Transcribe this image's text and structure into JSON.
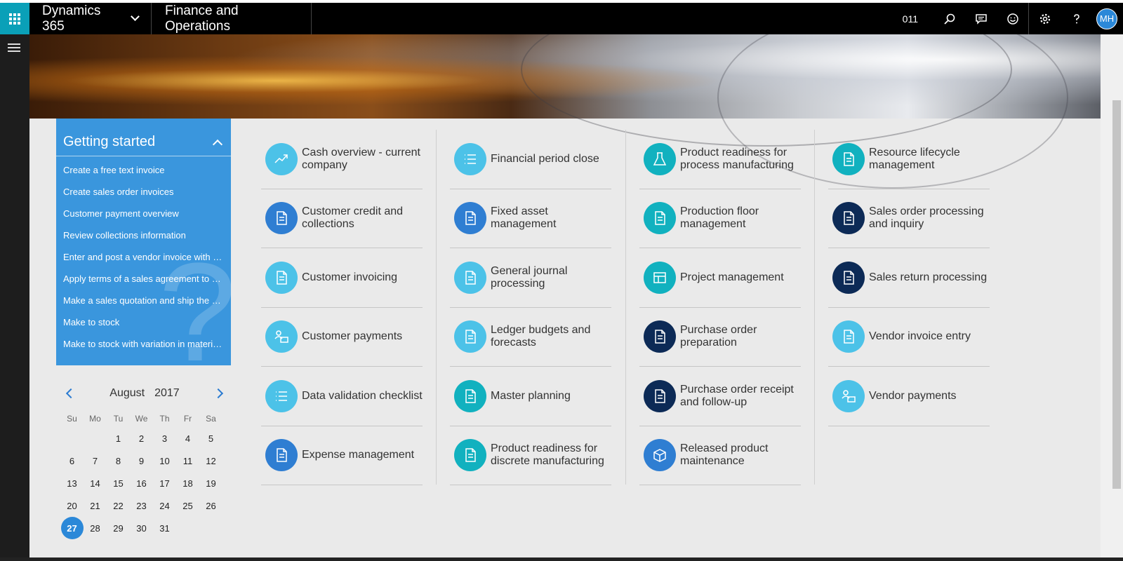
{
  "topbar": {
    "brand": "Dynamics 365",
    "module": "Finance and Operations",
    "company": "011",
    "avatar_initials": "MH",
    "icons": [
      "search-icon",
      "message-icon",
      "feedback-smiley-icon",
      "settings-icon",
      "help-icon"
    ]
  },
  "getting_started": {
    "title": "Getting started",
    "links": [
      "Create a free text invoice",
      "Create sales order invoices",
      "Customer payment overview",
      "Review collections information",
      "Enter and post a vendor invoice with m...",
      "Apply terms of a sales agreement to a ...",
      "Make a sales quotation and ship the or...",
      "Make to stock",
      "Make to stock with variation in materia..."
    ]
  },
  "calendar": {
    "month": "August",
    "year": "2017",
    "weekdays": [
      "Su",
      "Mo",
      "Tu",
      "We",
      "Th",
      "Fr",
      "Sa"
    ],
    "days": [
      "",
      "",
      "1",
      "2",
      "3",
      "4",
      "5",
      "6",
      "7",
      "8",
      "9",
      "10",
      "11",
      "12",
      "13",
      "14",
      "15",
      "16",
      "17",
      "18",
      "19",
      "20",
      "21",
      "22",
      "23",
      "24",
      "25",
      "26",
      "27",
      "28",
      "29",
      "30",
      "31"
    ],
    "today": "27"
  },
  "tiles": {
    "col1": [
      {
        "label": "Cash overview - current company",
        "icon": "trend-icon",
        "color": "#4cc2e8"
      },
      {
        "label": "Customer credit and collections",
        "icon": "credit-icon",
        "color": "#2f7ed2"
      },
      {
        "label": "Customer invoicing",
        "icon": "invoice-icon",
        "color": "#4cc2e8"
      },
      {
        "label": "Customer payments",
        "icon": "customer-payment-icon",
        "color": "#4cc2e8"
      },
      {
        "label": "Data validation checklist",
        "icon": "checklist-icon",
        "color": "#4cc2e8"
      },
      {
        "label": "Expense management",
        "icon": "expense-icon",
        "color": "#2f7ed2"
      }
    ],
    "col2": [
      {
        "label": "Financial period close",
        "icon": "list-icon",
        "color": "#4cc2e8"
      },
      {
        "label": "Fixed asset management",
        "icon": "asset-icon",
        "color": "#2f7ed2"
      },
      {
        "label": "General journal processing",
        "icon": "journal-icon",
        "color": "#4cc2e8"
      },
      {
        "label": "Ledger budgets and forecasts",
        "icon": "budget-icon",
        "color": "#4cc2e8"
      },
      {
        "label": "Master planning",
        "icon": "planning-icon",
        "color": "#11b1bf"
      },
      {
        "label": "Product readiness for discrete manufacturing",
        "icon": "product-readiness-icon",
        "color": "#11b1bf"
      }
    ],
    "col3": [
      {
        "label": "Product readiness for process manufacturing",
        "icon": "flask-icon",
        "color": "#11b1bf"
      },
      {
        "label": "Production floor management",
        "icon": "production-icon",
        "color": "#11b1bf"
      },
      {
        "label": "Project management",
        "icon": "project-icon",
        "color": "#11b1bf"
      },
      {
        "label": "Purchase order preparation",
        "icon": "purchase-prep-icon",
        "color": "#0c2a56"
      },
      {
        "label": "Purchase order receipt and follow-up",
        "icon": "purchase-receipt-icon",
        "color": "#0c2a56"
      },
      {
        "label": "Released product maintenance",
        "icon": "box-icon",
        "color": "#2f7ed2"
      }
    ],
    "col4": [
      {
        "label": "Resource lifecycle management",
        "icon": "resource-icon",
        "color": "#11b1bf"
      },
      {
        "label": "Sales order processing and inquiry",
        "icon": "sales-order-icon",
        "color": "#0c2a56"
      },
      {
        "label": "Sales return processing",
        "icon": "sales-return-icon",
        "color": "#0c2a56"
      },
      {
        "label": "Vendor invoice entry",
        "icon": "vendor-invoice-icon",
        "color": "#4cc2e8"
      },
      {
        "label": "Vendor payments",
        "icon": "vendor-payment-icon",
        "color": "#4cc2e8"
      }
    ]
  }
}
